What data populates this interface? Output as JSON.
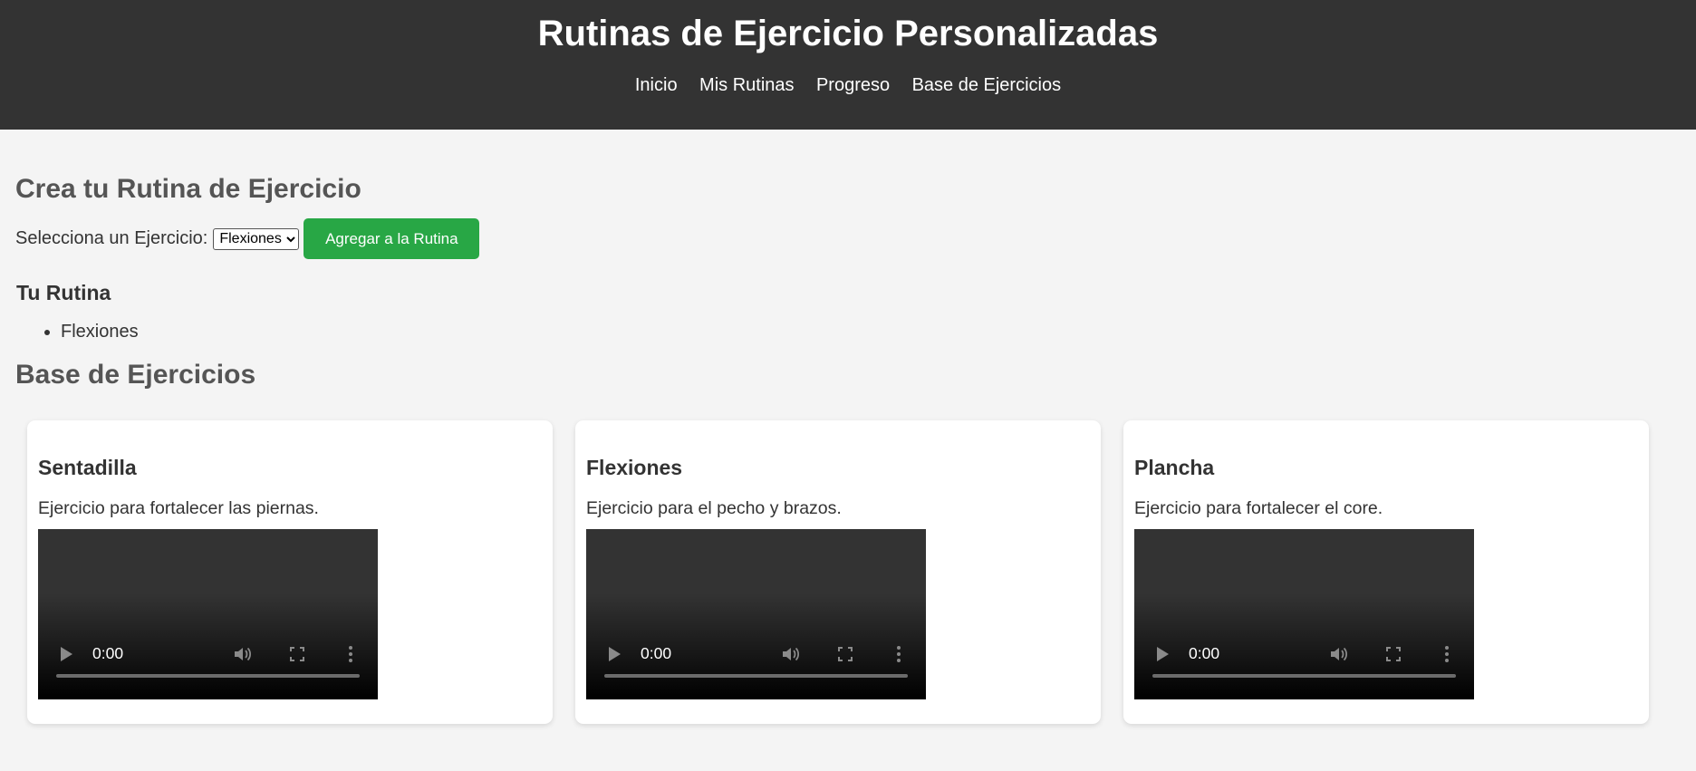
{
  "header": {
    "title": "Rutinas de Ejercicio Personalizadas",
    "nav": [
      "Inicio",
      "Mis Rutinas",
      "Progreso",
      "Base de Ejercicios"
    ]
  },
  "create": {
    "title": "Crea tu Rutina de Ejercicio",
    "select_label": "Selecciona un Ejercicio:",
    "selected_option": "Flexiones",
    "add_button": "Agregar a la Rutina"
  },
  "routine": {
    "title": "Tu Rutina",
    "items": [
      "Flexiones"
    ]
  },
  "database": {
    "title": "Base de Ejercicios",
    "cards": [
      {
        "name": "Sentadilla",
        "description": "Ejercicio para fortalecer las piernas.",
        "time": "0:00"
      },
      {
        "name": "Flexiones",
        "description": "Ejercicio para el pecho y brazos.",
        "time": "0:00"
      },
      {
        "name": "Plancha",
        "description": "Ejercicio para fortalecer el core.",
        "time": "0:00"
      }
    ]
  }
}
